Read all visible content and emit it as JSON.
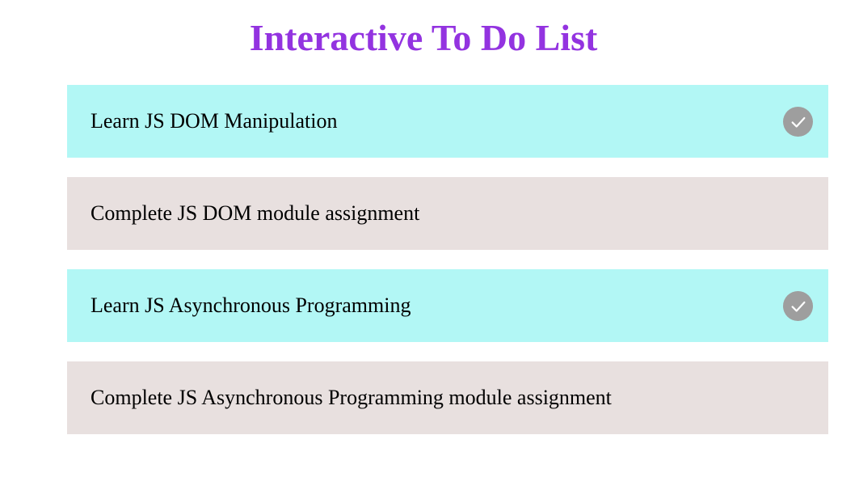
{
  "header": {
    "title": "Interactive To Do List"
  },
  "todos": [
    {
      "text": "Learn JS DOM Manipulation",
      "completed": true
    },
    {
      "text": "Complete JS DOM module assignment",
      "completed": false
    },
    {
      "text": "Learn JS Asynchronous Programming",
      "completed": true
    },
    {
      "text": "Complete JS Asynchronous Programming module assignment",
      "completed": false
    }
  ],
  "colors": {
    "title": "#9333e0",
    "completed_bg": "#b2f7f5",
    "pending_bg": "#e8e0df",
    "check_icon_bg": "#9e9e9e"
  },
  "icons": {
    "completed": "check-circle-icon"
  }
}
